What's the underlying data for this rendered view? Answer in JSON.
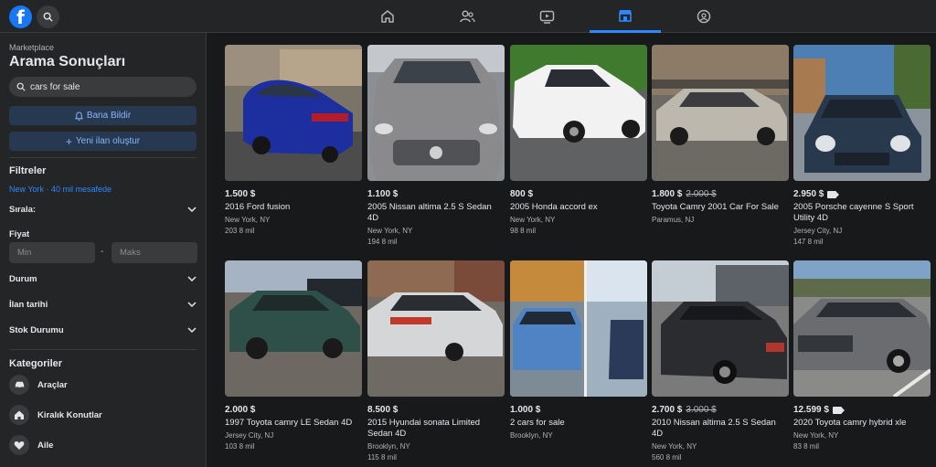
{
  "topbar": {
    "logo_letter": "f",
    "colors": {
      "accent": "#2d88ff",
      "brand": "#1877f2"
    }
  },
  "sidebar": {
    "section_label": "Marketplace",
    "title": "Arama Sonuçları",
    "search_value": "cars for sale",
    "notify_button": "Bana Bildir",
    "create_listing_button": "Yeni ilan oluştur",
    "filters_heading": "Filtreler",
    "location_link": "New York · 40 mil mesafede",
    "sort_label": "Sırala:",
    "price_label": "Fiyat",
    "price_min_placeholder": "Min",
    "price_max_placeholder": "Maks",
    "price_separator": "-",
    "condition_label": "Durum",
    "listing_date_label": "İlan tarihi",
    "stock_label": "Stok Durumu",
    "categories_heading": "Kategoriler",
    "categories": [
      {
        "label": "Araçlar",
        "icon": "car-icon"
      },
      {
        "label": "Kiralık Konutlar",
        "icon": "home-icon"
      },
      {
        "label": "Aile",
        "icon": "heart-icon"
      }
    ]
  },
  "listings": [
    {
      "price": "1.500 $",
      "old_price": "",
      "video": false,
      "title": "2016 Ford fusion",
      "location": "New York, NY",
      "distance": "203 8 mil"
    },
    {
      "price": "1.100 $",
      "old_price": "",
      "video": false,
      "title": "2005 Nissan altima 2.5 S Sedan 4D",
      "location": "New York, NY",
      "distance": "194 8 mil"
    },
    {
      "price": "800 $",
      "old_price": "",
      "video": false,
      "title": "2005 Honda accord ex",
      "location": "New York, NY",
      "distance": "98 8 mil"
    },
    {
      "price": "1.800 $",
      "old_price": "2.000 $",
      "video": false,
      "title": "Toyota Camry 2001 Car For Sale",
      "location": "Paramus, NJ",
      "distance": ""
    },
    {
      "price": "2.950 $",
      "old_price": "",
      "video": true,
      "title": "2005 Porsche cayenne S Sport Utility 4D",
      "location": "Jersey City, NJ",
      "distance": "147 8 mil"
    },
    {
      "price": "2.000 $",
      "old_price": "",
      "video": false,
      "title": "1997 Toyota camry LE Sedan 4D",
      "location": "Jersey City, NJ",
      "distance": "103 8 mil"
    },
    {
      "price": "8.500 $",
      "old_price": "",
      "video": false,
      "title": "2015 Hyundai sonata Limited Sedan 4D",
      "location": "Brooklyn, NY",
      "distance": "115 8 mil"
    },
    {
      "price": "1.000 $",
      "old_price": "",
      "video": false,
      "title": "2 cars for sale",
      "location": "Brooklyn, NY",
      "distance": ""
    },
    {
      "price": "2.700 $",
      "old_price": "3.000 $",
      "video": false,
      "title": "2010 Nissan altima 2.5 S Sedan 4D",
      "location": "New York, NY",
      "distance": "560 8 mil"
    },
    {
      "price": "12.599 $",
      "old_price": "",
      "video": true,
      "title": "2020 Toyota camry hybrid xle",
      "location": "New York, NY",
      "distance": "83 8 mil"
    }
  ]
}
